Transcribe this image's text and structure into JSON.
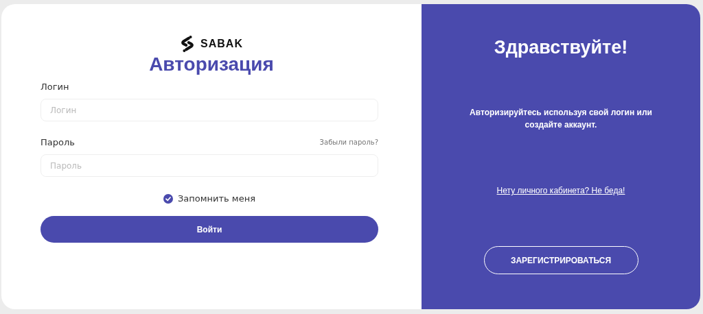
{
  "logo": {
    "name": "SABAK"
  },
  "login_form": {
    "title": "Авторизация",
    "fields": [
      {
        "label": "Логин",
        "placeholder": "Логин"
      },
      {
        "label": "Пароль",
        "placeholder": "Пароль",
        "link": "Забыли пароль?"
      }
    ],
    "remember": {
      "label": "Запомнить меня",
      "checked": true
    },
    "submit": "Войти"
  },
  "welcome_panel": {
    "title": "Здравствуйте!",
    "text": "Авторизируйтесь используя свой логин или создайте аккаунт.",
    "link": "Нету личного кабинета? Не беда!",
    "button": "ЗАРЕГИСТРИРОВАТЬСЯ"
  }
}
